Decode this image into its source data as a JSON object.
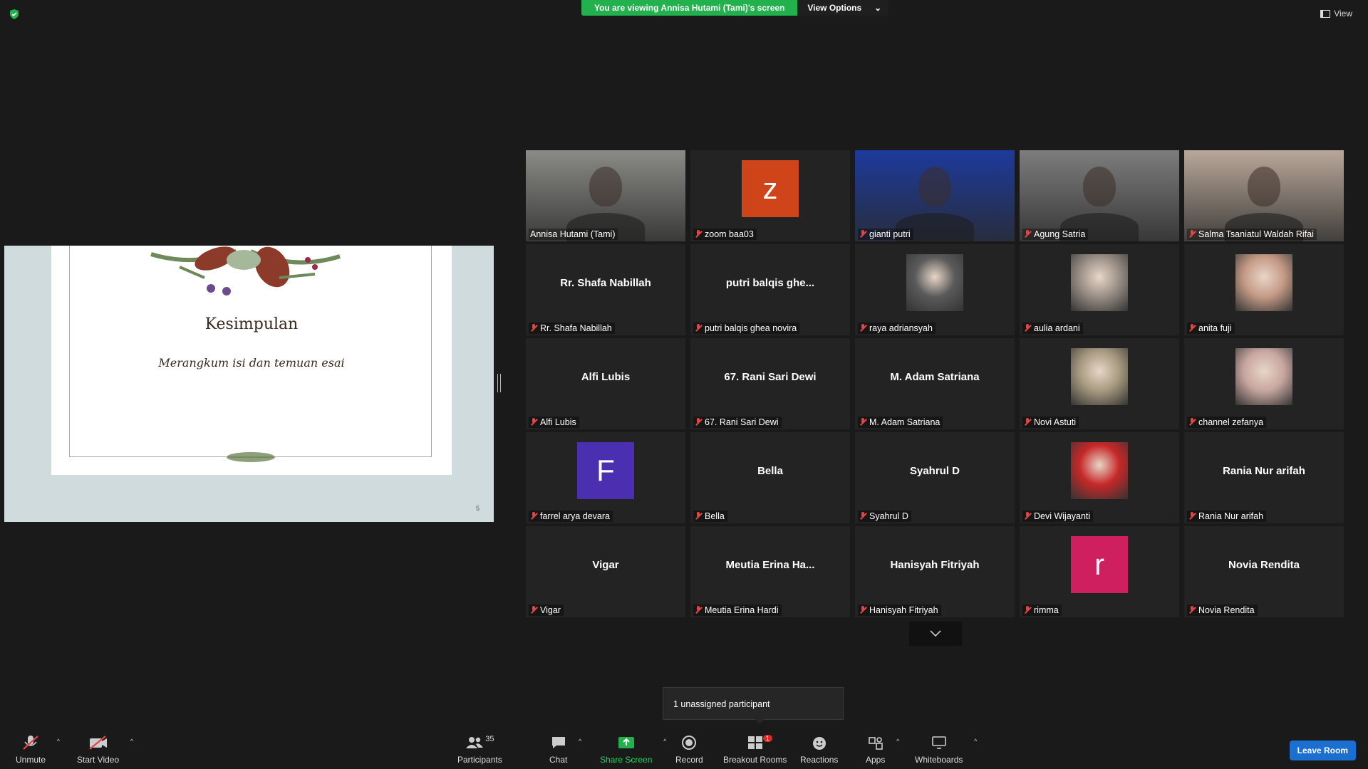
{
  "banner": {
    "viewing": "You are viewing Annisa Hutami (Tami)'s screen",
    "options": "View Options"
  },
  "view_button": "View",
  "shared_slide": {
    "title": "Kesimpulan",
    "subtitle": "Merangkum isi dan temuan esai",
    "page_number": "5"
  },
  "participants": [
    {
      "label": "Annisa Hutami (Tami)",
      "display": "video",
      "active": true,
      "video_color": "#8a8a86"
    },
    {
      "label": "zoom baa03",
      "display": "avatar",
      "initial": "z",
      "avatar_color": "#d0441a"
    },
    {
      "label": "gianti putri",
      "display": "video",
      "video_color": "#1d3a9c"
    },
    {
      "label": "Agung Satria",
      "display": "video",
      "video_color": "#7d7d7d"
    },
    {
      "label": "Salma Tsaniatul Waldah Rifai",
      "display": "video",
      "video_color": "#b9a89a"
    },
    {
      "label": "Rr. Shafa Nabillah",
      "display": "name",
      "name": "Rr. Shafa Nabillah"
    },
    {
      "label": "putri balqis ghea novira",
      "display": "name",
      "name": "putri  balqis  ghe..."
    },
    {
      "label": "raya adriansyah",
      "display": "photo",
      "photo_color": "#5a5a5a"
    },
    {
      "label": "aulia ardani",
      "display": "photo",
      "photo_color": "#9a8f86"
    },
    {
      "label": "anita fuji",
      "display": "photo",
      "photo_color": "#c59a86"
    },
    {
      "label": "Alfi Lubis",
      "display": "name",
      "name": "Alfi Lubis"
    },
    {
      "label": "67. Rani Sari Dewi",
      "display": "name",
      "name": "67. Rani Sari Dewi"
    },
    {
      "label": "M. Adam Satriana",
      "display": "name",
      "name": "M. Adam Satriana"
    },
    {
      "label": "Novi Astuti",
      "display": "photo",
      "photo_color": "#a89a80"
    },
    {
      "label": "channel zefanya",
      "display": "photo",
      "photo_color": "#c8a6a0"
    },
    {
      "label": "farrel arya devara",
      "display": "avatar",
      "initial": "F",
      "avatar_color": "#4a2fb0"
    },
    {
      "label": "Bella",
      "display": "name",
      "name": "Bella"
    },
    {
      "label": "Syahrul D",
      "display": "name",
      "name": "Syahrul D"
    },
    {
      "label": "Devi Wijayanti",
      "display": "photo",
      "photo_color": "#c62828"
    },
    {
      "label": "Rania Nur arifah",
      "display": "name",
      "name": "Rania Nur arifah"
    },
    {
      "label": "Vigar",
      "display": "name",
      "name": "Vigar"
    },
    {
      "label": "Meutia Erina Hardi",
      "display": "name",
      "name": "Meutia  Erina  Ha..."
    },
    {
      "label": "Hanisyah Fitriyah",
      "display": "name",
      "name": "Hanisyah Fitriyah"
    },
    {
      "label": "rimma",
      "display": "avatar",
      "initial": "r",
      "avatar_color": "#cf1f5e"
    },
    {
      "label": "Novia Rendita",
      "display": "name",
      "name": "Novia Rendita"
    }
  ],
  "tooltip": "1 unassigned participant",
  "toolbar": {
    "unmute": "Unmute",
    "start_video": "Start Video",
    "participants": "Participants",
    "participants_count": "35",
    "chat": "Chat",
    "share_screen": "Share Screen",
    "record": "Record",
    "breakout_rooms": "Breakout Rooms",
    "breakout_badge": "1",
    "reactions": "Reactions",
    "apps": "Apps",
    "whiteboards": "Whiteboards",
    "leave_room": "Leave Room"
  },
  "colors": {
    "accent_green": "#23b14d",
    "active_border": "#c9e64b",
    "leave_blue": "#1a6fd0",
    "muted_red": "#e34444"
  }
}
